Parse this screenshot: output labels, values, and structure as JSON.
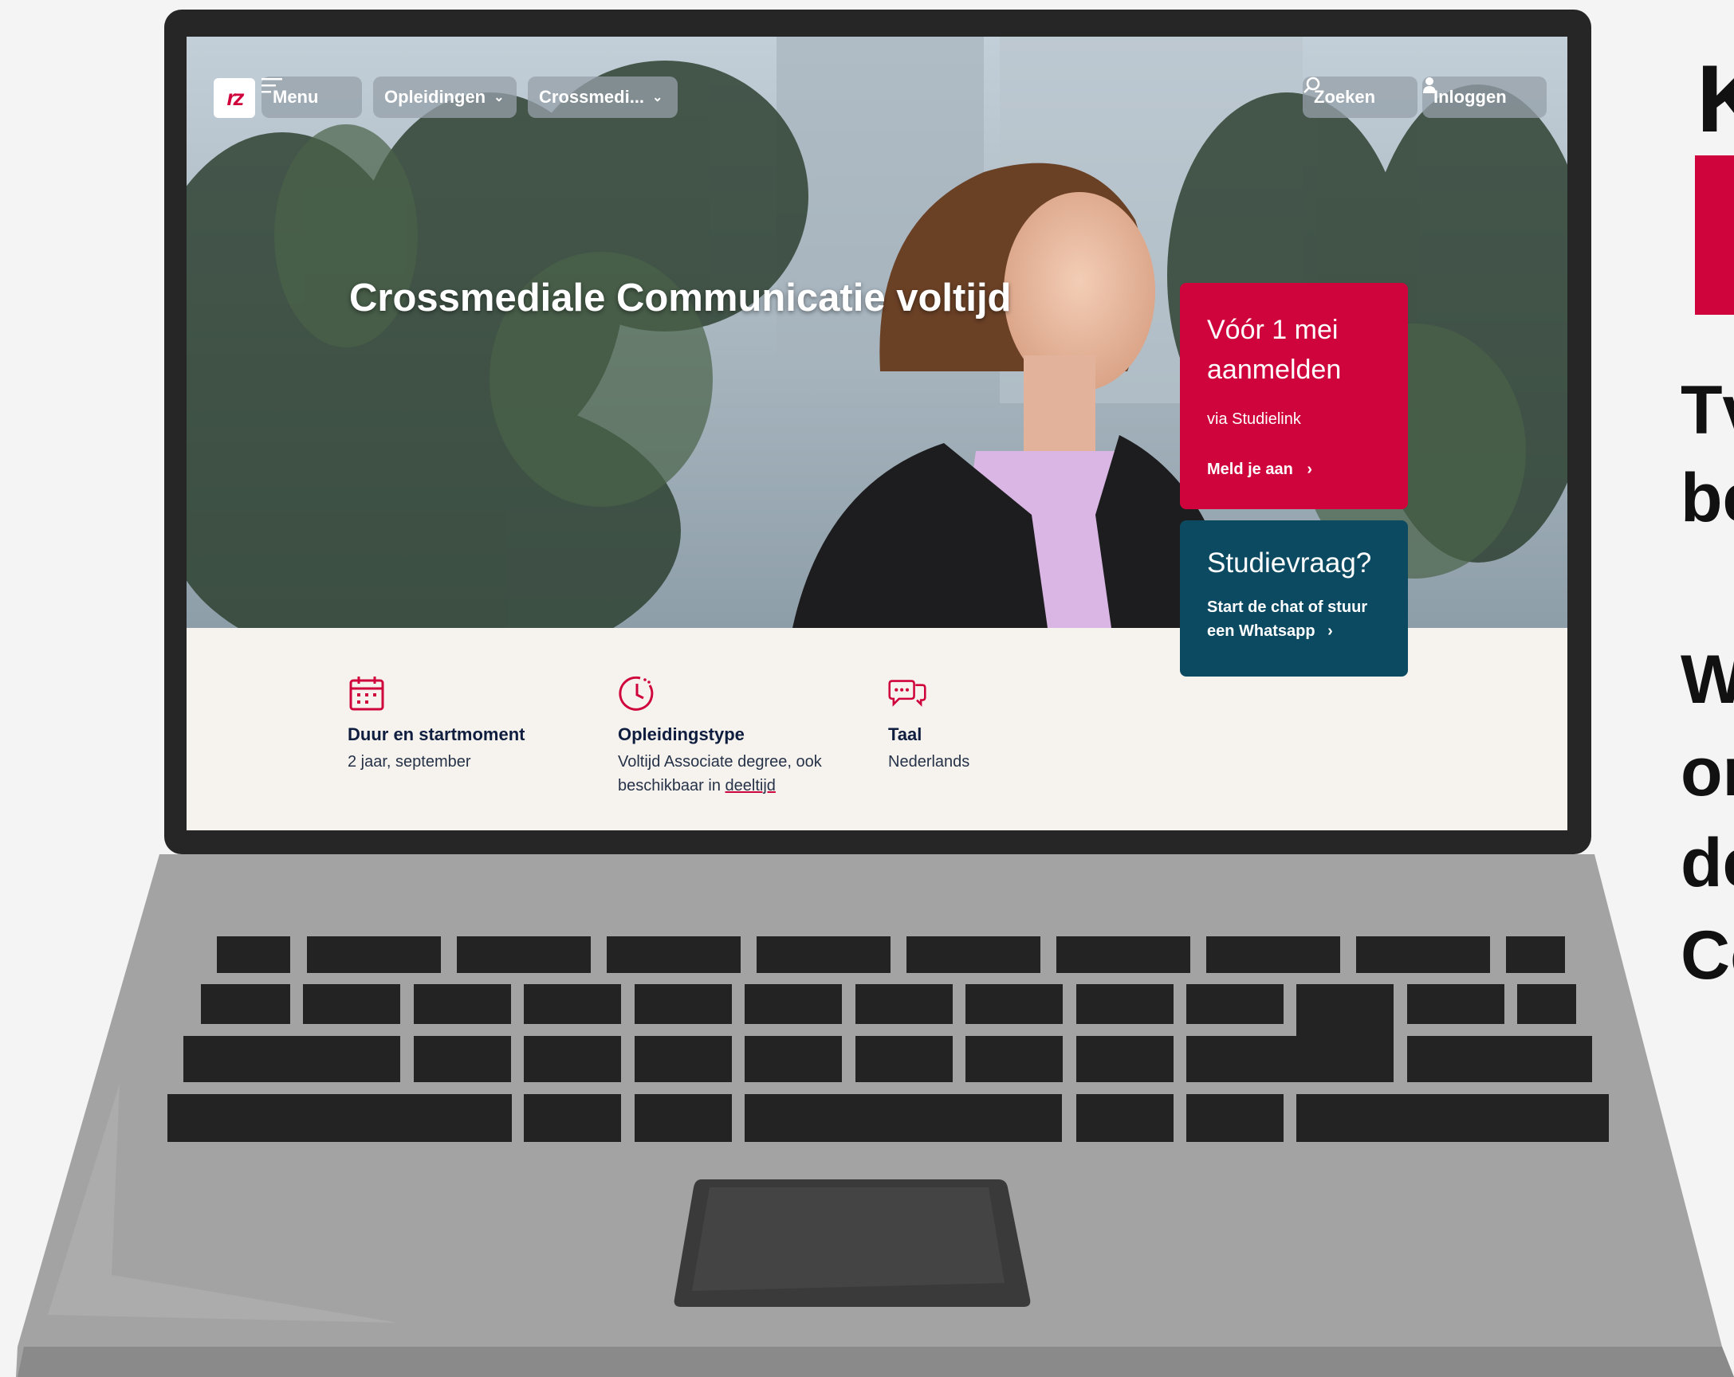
{
  "nav": {
    "menu_label": "Menu",
    "opleidingen_label": "Opleidingen",
    "crossmedia_label": "Crossmedi...",
    "search_label": "Zoeken",
    "login_label": "Inloggen"
  },
  "hero": {
    "title": "Crossmediale Communicatie voltijd"
  },
  "apply_card": {
    "heading_line1": "Vóór 1 mei",
    "heading_line2": "aanmelden",
    "subtitle": "via Studielink",
    "cta": "Meld je aan"
  },
  "question_card": {
    "heading": "Studievraag?",
    "cta": "Start de chat of stuur een Whatsapp"
  },
  "info": [
    {
      "label": "Duur en startmoment",
      "value": "2 jaar, september",
      "icon": "calendar-icon"
    },
    {
      "label": "Opleidingstype",
      "value": "Voltijd Associate degree, ook beschikbaar in ",
      "link": "deeltijd",
      "icon": "clock-icon"
    },
    {
      "label": "Taal",
      "value": "Nederlands",
      "icon": "chat-bubbles-icon"
    }
  ],
  "side_text": {
    "heading": "K",
    "lines": [
      "Tv",
      "be",
      "W",
      "or",
      "de",
      "Co"
    ]
  },
  "colors": {
    "accent_red": "#d0043c",
    "petrol": "#0c4a62",
    "navy_text": "#0f1d3f"
  }
}
